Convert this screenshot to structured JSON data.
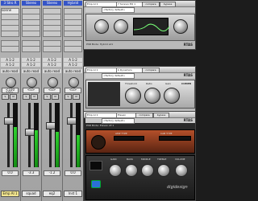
{
  "mixer": {
    "channels": [
      {
        "id": "ch1",
        "header": "3 Stro R",
        "slot1": "sonne",
        "slot2": "",
        "in": "A 1-2",
        "out": "A 1-2",
        "mode": "auto read",
        "pan": "<100 100>",
        "vol": "0.0",
        "name": "Emp AI 1",
        "sel": true
      },
      {
        "id": "ch2",
        "header": "Stereo",
        "slot1": "",
        "slot2": "",
        "in": "A 1-2",
        "out": "A 1-2",
        "mode": "auto read",
        "pan": "<0>",
        "vol": "-3.3",
        "name": "squad",
        "sel": false
      },
      {
        "id": "ch3",
        "header": "Stereo",
        "slot1": "",
        "slot2": "",
        "in": "A 1-2",
        "out": "A 1-2",
        "mode": "auto read",
        "pan": "<0>",
        "vol": "-1.2",
        "name": "eq2",
        "sel": false
      },
      {
        "id": "ch4",
        "header": "Hybrid",
        "slot1": "",
        "slot2": "",
        "in": "A 1-2",
        "out": "A 1-2",
        "mode": "auto read",
        "pan": "<0>",
        "vol": "0.0",
        "name": "lnst 1",
        "sel": false
      }
    ],
    "meter_levels": [
      0.62,
      0.58,
      0.55,
      0.5
    ]
  },
  "plugin1": {
    "track": "Emp AI 1",
    "preset": "<factory default>",
    "insert": "7 Sonnox EQ 1",
    "compare": "compare",
    "bypass": "bypass",
    "plugin_name": "Sonnox Oxford EQ",
    "rtas": "RTAS",
    "mode_label": "PSB Mode: Hybrid Ld1"
  },
  "plugin2": {
    "track": "Emp AI 1",
    "preset": "<factory default>",
    "compare": "compare",
    "insert": "b Dynamics",
    "rtas": "RTAS",
    "comp_label": "COMPR",
    "threshold_label": "Threshold",
    "ratio_label": "Ratio",
    "gain_label": "Gain"
  },
  "plugin3": {
    "track": "Emp AI 1",
    "preset": "<factory default>",
    "compare": "compare",
    "bypass": "bypass",
    "insert": "Eleven",
    "rtas": "RTAS",
    "amp_type_label": "AMP TYPE",
    "cab_type_label": "CAB TYPE",
    "brand": "digidesign",
    "mode_label": "PSB Mode: Eleven LE 1",
    "labels": [
      "GAIN",
      "BASS",
      "MIDDLE",
      "TREBLE",
      "VOLUME"
    ]
  },
  "colors": {
    "accent": "#3555c7",
    "selected": "#f3e68f",
    "meter": "#2fd12f"
  }
}
